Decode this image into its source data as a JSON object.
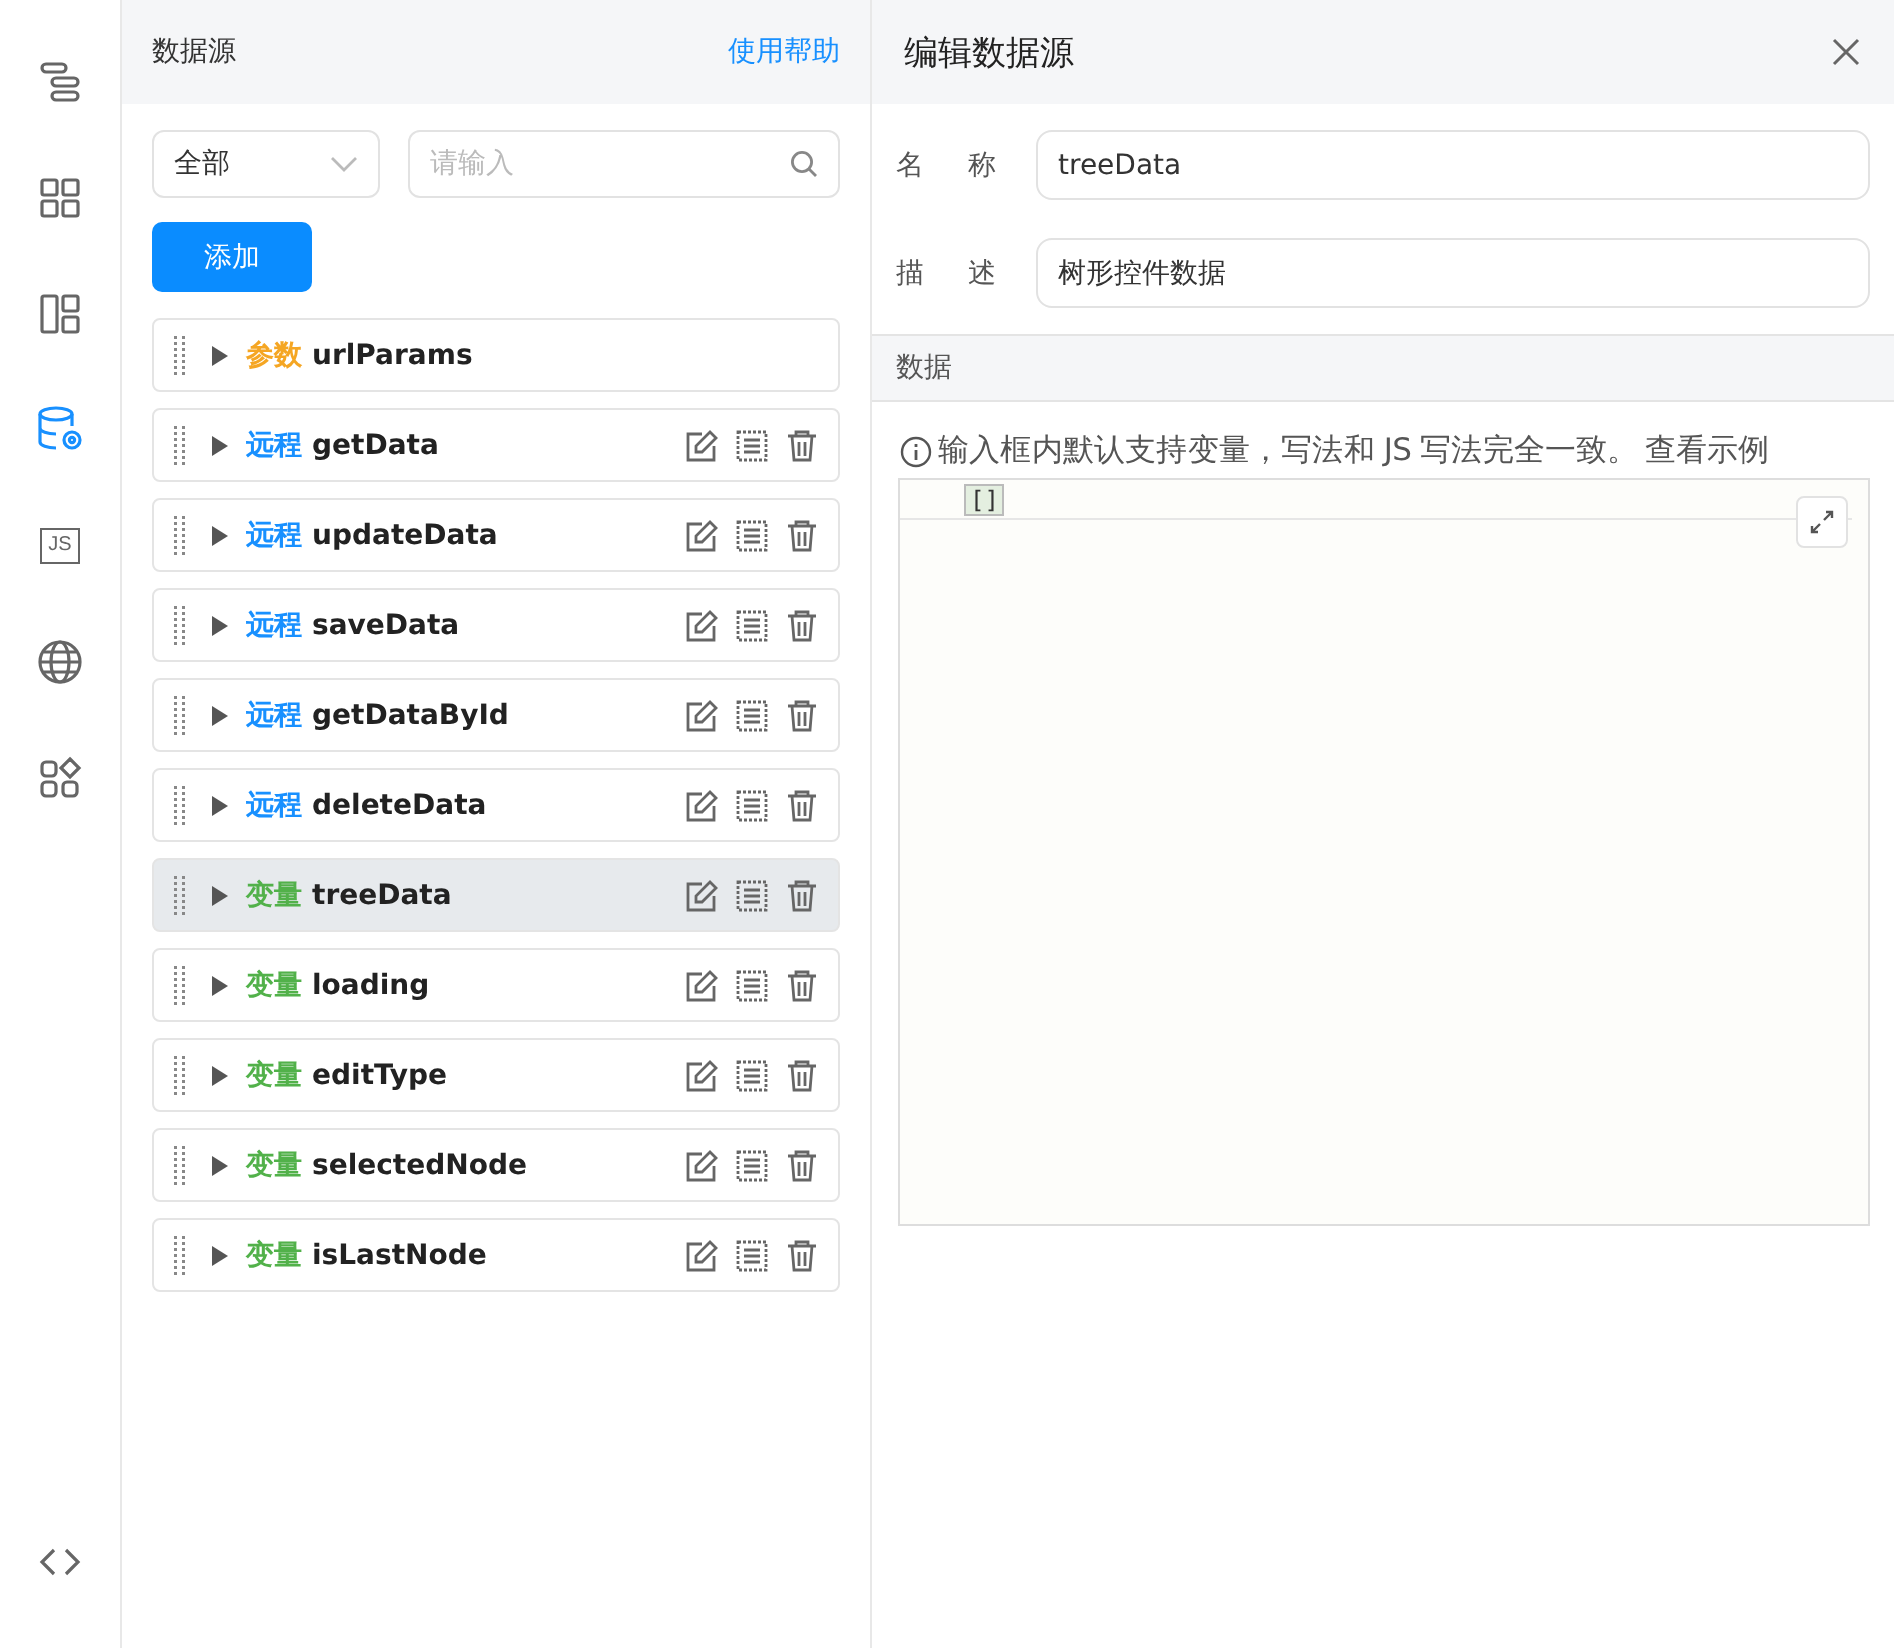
{
  "sidebar": {
    "items": [
      {
        "kind": "outline",
        "selected": false
      },
      {
        "kind": "grid",
        "selected": false
      },
      {
        "kind": "layout",
        "selected": false
      },
      {
        "kind": "database",
        "selected": true
      },
      {
        "kind": "js",
        "label": "JS",
        "selected": false
      },
      {
        "kind": "globe",
        "selected": false
      },
      {
        "kind": "blocks",
        "selected": false
      }
    ],
    "bottom": {
      "kind": "code"
    }
  },
  "list_panel": {
    "title": "数据源",
    "help_link": "使用帮助",
    "filter": {
      "value": "全部"
    },
    "search": {
      "placeholder": "请输入"
    },
    "add_button": "添加",
    "items": [
      {
        "kind": "param",
        "tag": "参数",
        "name": "urlParams",
        "selected": false,
        "actions": false
      },
      {
        "kind": "remote",
        "tag": "远程",
        "name": "getData",
        "selected": false,
        "actions": true
      },
      {
        "kind": "remote",
        "tag": "远程",
        "name": "updateData",
        "selected": false,
        "actions": true
      },
      {
        "kind": "remote",
        "tag": "远程",
        "name": "saveData",
        "selected": false,
        "actions": true
      },
      {
        "kind": "remote",
        "tag": "远程",
        "name": "getDataById",
        "selected": false,
        "actions": true
      },
      {
        "kind": "remote",
        "tag": "远程",
        "name": "deleteData",
        "selected": false,
        "actions": true
      },
      {
        "kind": "variable",
        "tag": "变量",
        "name": "treeData",
        "selected": true,
        "actions": true
      },
      {
        "kind": "variable",
        "tag": "变量",
        "name": "loading",
        "selected": false,
        "actions": true
      },
      {
        "kind": "variable",
        "tag": "变量",
        "name": "editType",
        "selected": false,
        "actions": true
      },
      {
        "kind": "variable",
        "tag": "变量",
        "name": "selectedNode",
        "selected": false,
        "actions": true
      },
      {
        "kind": "variable",
        "tag": "变量",
        "name": "isLastNode",
        "selected": false,
        "actions": true
      }
    ]
  },
  "editor": {
    "title": "编辑数据源",
    "fields": [
      {
        "label": "名 称",
        "value": "treeData"
      },
      {
        "label": "描 述",
        "value": "树形控件数据"
      }
    ],
    "section": "数据",
    "hint": "输入框内默认支持变量，写法和 JS 写法完全一致。",
    "example_link": "查看示例",
    "code": "[]"
  }
}
